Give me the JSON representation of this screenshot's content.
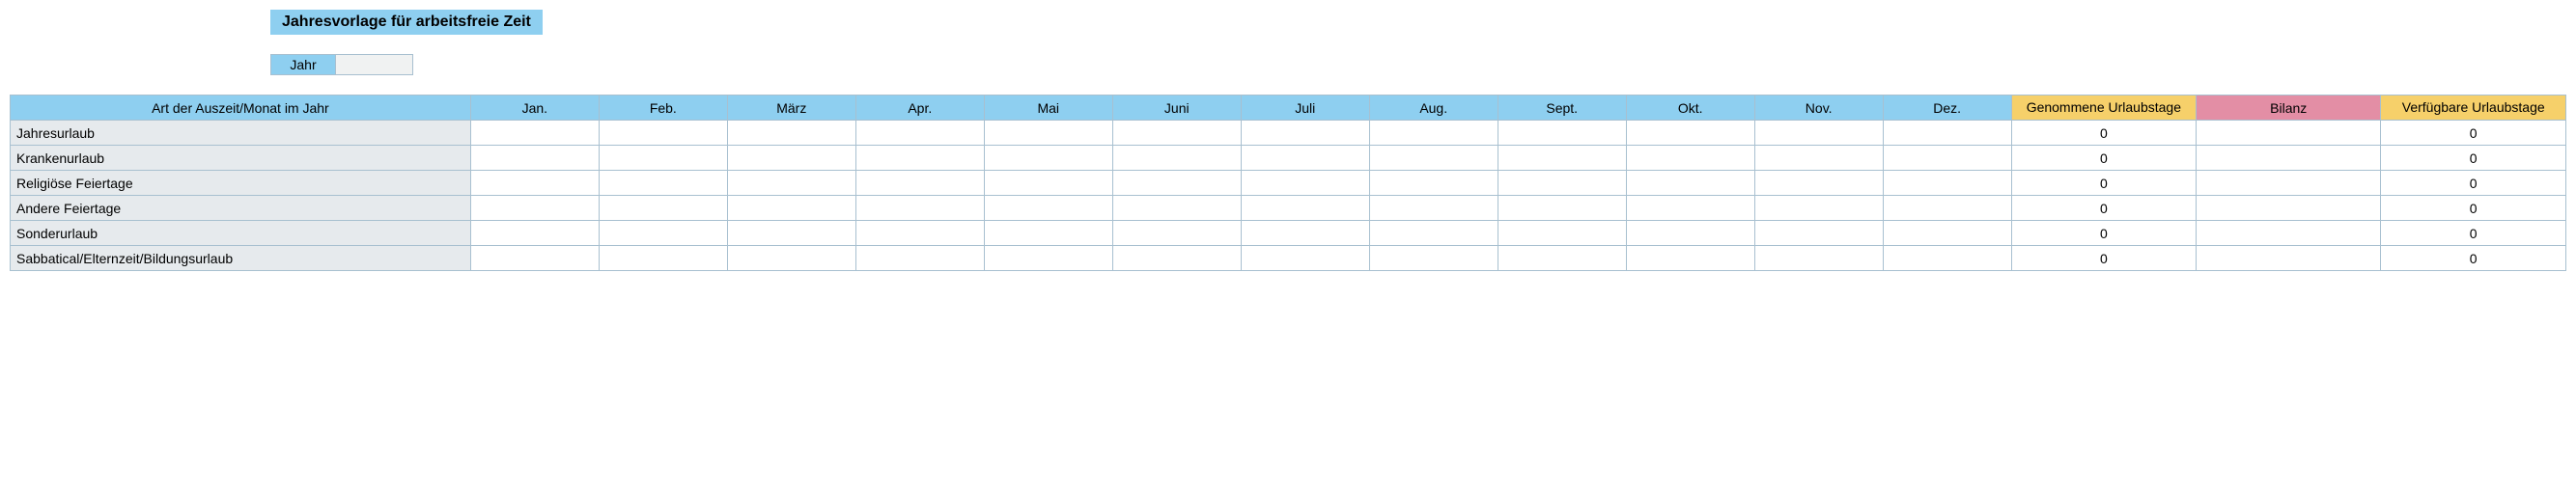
{
  "title": "Jahresvorlage für arbeitsfreie Zeit",
  "year_label": "Jahr",
  "year_value": "",
  "headers": {
    "type": "Art der Auszeit/Monat im Jahr",
    "months": [
      "Jan.",
      "Feb.",
      "März",
      "Apr.",
      "Mai",
      "Juni",
      "Juli",
      "Aug.",
      "Sept.",
      "Okt.",
      "Nov.",
      "Dez."
    ],
    "taken": "Genommene Urlaubstage",
    "balance": "Bilanz",
    "available": "Verfügbare Urlaubstage"
  },
  "rows": [
    {
      "label": "Jahresurlaub",
      "months": [
        "",
        "",
        "",
        "",
        "",
        "",
        "",
        "",
        "",
        "",
        "",
        ""
      ],
      "taken": "0",
      "balance": "",
      "available": "0"
    },
    {
      "label": "Krankenurlaub",
      "months": [
        "",
        "",
        "",
        "",
        "",
        "",
        "",
        "",
        "",
        "",
        "",
        ""
      ],
      "taken": "0",
      "balance": "",
      "available": "0"
    },
    {
      "label": "Religiöse Feiertage",
      "months": [
        "",
        "",
        "",
        "",
        "",
        "",
        "",
        "",
        "",
        "",
        "",
        ""
      ],
      "taken": "0",
      "balance": "",
      "available": "0"
    },
    {
      "label": "Andere Feiertage",
      "months": [
        "",
        "",
        "",
        "",
        "",
        "",
        "",
        "",
        "",
        "",
        "",
        ""
      ],
      "taken": "0",
      "balance": "",
      "available": "0"
    },
    {
      "label": "Sonderurlaub",
      "months": [
        "",
        "",
        "",
        "",
        "",
        "",
        "",
        "",
        "",
        "",
        "",
        ""
      ],
      "taken": "0",
      "balance": "",
      "available": "0"
    },
    {
      "label": "Sabbatical/Elternzeit/Bildungsurlaub",
      "months": [
        "",
        "",
        "",
        "",
        "",
        "",
        "",
        "",
        "",
        "",
        "",
        ""
      ],
      "taken": "0",
      "balance": "",
      "available": "0"
    }
  ]
}
